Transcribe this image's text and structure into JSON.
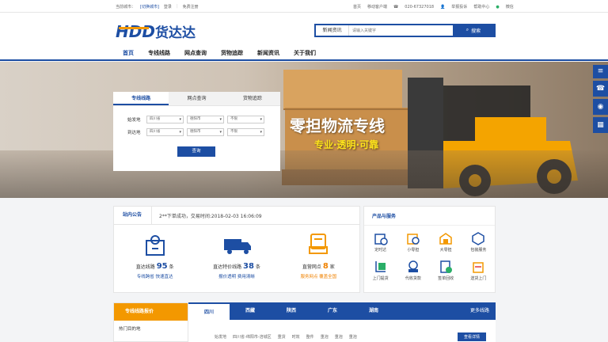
{
  "topbar": {
    "city": "当前城市：",
    "city_switch": "[切换城市]",
    "login": "登录",
    "register": "免费注册",
    "home": "首页",
    "mobile": "移动客户端",
    "phone": "020-67327018",
    "report": "举报投诉",
    "help": "帮助中心",
    "wechat": "微信"
  },
  "logo": {
    "letters": "HDD",
    "name": "货达达"
  },
  "search": {
    "category": "新闻资讯",
    "placeholder": "请输入关键字",
    "button": "搜索"
  },
  "nav": [
    "首页",
    "专线线路",
    "网点查询",
    "货物追踪",
    "新闻资讯",
    "关于我们"
  ],
  "query": {
    "tabs": [
      "专线线路",
      "网点查询",
      "货物追踪"
    ],
    "from_label": "始发地",
    "to_label": "到达地",
    "from": [
      "四川省",
      "德阳市",
      "不限"
    ],
    "to": [
      "四川省",
      "德阳市",
      "不限"
    ],
    "button": "查询"
  },
  "banner": {
    "slogan": "零担物流专线",
    "slogan2": "专业·透明·可靠"
  },
  "notice": {
    "title": "站内公告",
    "text": "2**下单成功，交易时间:2018-02-03 16:06:09"
  },
  "stats": [
    {
      "label": "直达线路",
      "value": "95",
      "unit": "条",
      "sub": "专线跨省 快速直达"
    },
    {
      "label": "直达特价线路",
      "value": "38",
      "unit": "条",
      "sub": "报价透明 费用清晰"
    },
    {
      "label": "直营网点",
      "value": "8",
      "unit": "家",
      "sub": "服务网点 覆盖全国"
    }
  ],
  "services": {
    "title": "产品与服务",
    "items": [
      "定时达",
      "小零担",
      "大零担",
      "包装服务",
      "上门提货",
      "代收货款",
      "签单回收",
      "送货上门"
    ]
  },
  "routes": {
    "left_title": "专线线路报价",
    "left_sub": "热门目的地",
    "tabs": [
      "四川",
      "西藏",
      "陕西",
      "广东",
      "湖南"
    ],
    "more": "更多线路",
    "row": {
      "from_label": "始发地",
      "from": "四川省-绵阳市-涪城区",
      "cols": [
        "重货",
        "时效",
        "整件",
        "重泡",
        "重泡",
        "重泡"
      ],
      "button": "查看详情"
    }
  },
  "colors": {
    "primary": "#1d4ea3",
    "orange": "#f39800"
  }
}
